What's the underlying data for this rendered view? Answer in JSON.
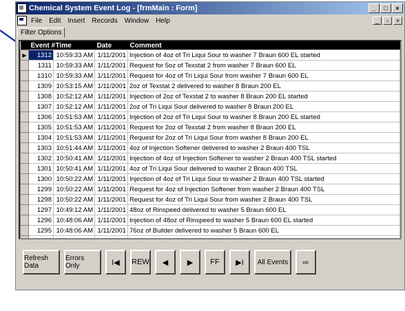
{
  "window": {
    "title": "Chemical System Event Log - [frmMain : Form]",
    "controls": [
      "_",
      "□",
      "×"
    ]
  },
  "menu": {
    "items": [
      "File",
      "Edit",
      "Insert",
      "Records",
      "Window",
      "Help"
    ],
    "doc_controls": [
      "_",
      "▫",
      "×"
    ]
  },
  "tab": {
    "label": "Filter Options"
  },
  "grid": {
    "columns": [
      "Event #",
      "Time",
      "Date",
      "Comment"
    ],
    "rows": [
      {
        "event": "1312",
        "time": "10:59:33 AM",
        "date": "1/11/2001",
        "comment": "Injection of 4oz of Tri Liqui Sour to washer 7 Braun 600 EL started"
      },
      {
        "event": "1311",
        "time": "10:59:33 AM",
        "date": "1/11/2001",
        "comment": "Request for 5oz of Texstat 2 from washer 7 Braun 600 EL"
      },
      {
        "event": "1310",
        "time": "10:59:33 AM",
        "date": "1/11/2001",
        "comment": "Request for 4oz of Tri Liqui Sour from washer 7 Braun 600 EL"
      },
      {
        "event": "1309",
        "time": "10:53:15 AM",
        "date": "1/11/2001",
        "comment": "2oz of Texstat 2 delivered to washer 8 Braun 200 EL"
      },
      {
        "event": "1308",
        "time": "10:52:12 AM",
        "date": "1/11/2001",
        "comment": "Injection of 2oz of Texstat 2 to washer 8 Braun 200 EL started"
      },
      {
        "event": "1307",
        "time": "10:52:12 AM",
        "date": "1/11/2001",
        "comment": "2oz of Tri Liqui Sour delivered to washer 8 Braun 200 EL"
      },
      {
        "event": "1306",
        "time": "10:51:53 AM",
        "date": "1/11/2001",
        "comment": "Injection of 2oz of Tri Liqui Sour to washer 8 Braun 200 EL started"
      },
      {
        "event": "1305",
        "time": "10:51:53 AM",
        "date": "1/11/2001",
        "comment": "Request for 2oz of Texstat 2 from washer 8 Braun 200 EL"
      },
      {
        "event": "1304",
        "time": "10:51:53 AM",
        "date": "1/11/2001",
        "comment": "Request for 2oz of Tri Liqui Sour from washer 8 Braun 200 EL"
      },
      {
        "event": "1303",
        "time": "10:51:44 AM",
        "date": "1/11/2001",
        "comment": "4oz of Injection Softener delivered to washer 2 Braun 400 TSL"
      },
      {
        "event": "1302",
        "time": "10:50:41 AM",
        "date": "1/11/2001",
        "comment": "Injection of 4oz of Injection Softener to washer 2 Braun 400 TSL started"
      },
      {
        "event": "1301",
        "time": "10:50:41 AM",
        "date": "1/11/2001",
        "comment": "4oz of Tri Liqui Sour delivered to washer 2 Braun 400 TSL"
      },
      {
        "event": "1300",
        "time": "10:50:22 AM",
        "date": "1/11/2001",
        "comment": "Injection of 4oz of Tri Liqui Sour to washer 2 Braun 400 TSL started"
      },
      {
        "event": "1299",
        "time": "10:50:22 AM",
        "date": "1/11/2001",
        "comment": "Request for 4oz of Injection Softener from washer 2 Braun 400 TSL"
      },
      {
        "event": "1298",
        "time": "10:50:22 AM",
        "date": "1/11/2001",
        "comment": "Request for 4oz of Tri Liqui Sour from washer 2 Braun 400 TSL"
      },
      {
        "event": "1297",
        "time": "10:49:12 AM",
        "date": "1/11/2001",
        "comment": "48oz of Rinspeed delivered to washer 5 Braun 600 EL"
      },
      {
        "event": "1296",
        "time": "10:48:06 AM",
        "date": "1/11/2001",
        "comment": "Injection of 48oz of Rinspeed to washer 5 Braun 600 EL started"
      },
      {
        "event": "1295",
        "time": "10:48:06 AM",
        "date": "1/11/2001",
        "comment": "76oz of Builder delivered to washer 5 Braun 600 EL"
      },
      {
        "event": "1294",
        "time": "10:47:33 AM",
        "date": "1/11/2001",
        "comment": "Injection of 76oz of Builder to washer 5 Braun 600 EL started"
      }
    ]
  },
  "buttons": {
    "refresh": "Refresh Data",
    "errors_only": "Errors Only",
    "first": "I◀",
    "rew": "REW",
    "prev": "◀",
    "next": "▶",
    "ff": "FF",
    "last": "▶I",
    "all_events": "All Events",
    "exit": "⇨"
  },
  "colors": {
    "title_start": "#0a246a",
    "title_end": "#a6caf0",
    "header_bg": "#000000",
    "pointer": "#1f3b9a"
  }
}
